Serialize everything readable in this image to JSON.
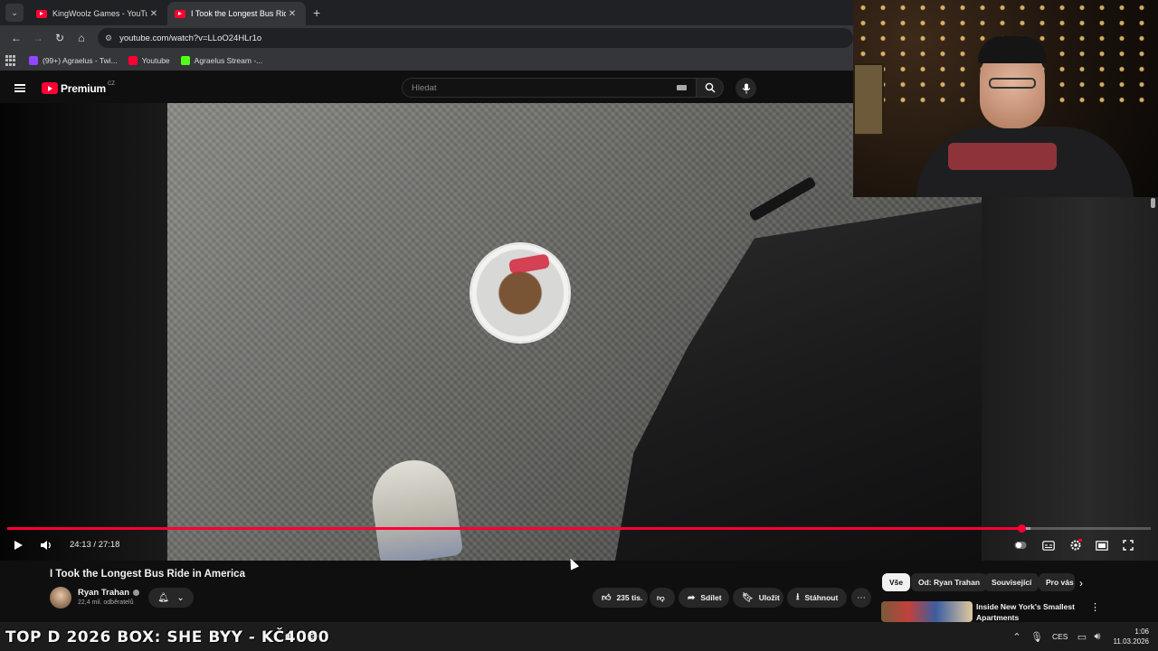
{
  "browser": {
    "tabs": [
      {
        "title": "KingWoolz Games - YouTube",
        "active": false
      },
      {
        "title": "I Took the Longest Bus Ride in A",
        "active": true
      }
    ],
    "new_tab_symbol": "+",
    "url": "youtube.com/watch?v=LLoO24HLr1o",
    "bookmarks": [
      {
        "label": "(99+) Agraelus - Twi...",
        "icon_color": "#9146ff"
      },
      {
        "label": "Youtube",
        "icon_color": "#ff0033"
      },
      {
        "label": "Agraelus Stream -...",
        "icon_color": "#53fc18"
      }
    ]
  },
  "youtube": {
    "logo_text": "Premium",
    "logo_region": "CZ",
    "search_placeholder": "Hledat"
  },
  "player": {
    "current_time": "24:13",
    "duration": "27:18",
    "time_display": "24:13 / 27:18",
    "progress_fraction": 0.887,
    "buffer_fraction": 0.895,
    "accent_color": "#ff0033"
  },
  "video": {
    "title": "I Took the Longest Bus Ride in America",
    "channel": "Ryan Trahan",
    "subscribers": "22,4 mil. odběratelů",
    "likes": "235 tis.",
    "share_label": "Sdílet",
    "save_label": "Uložit",
    "download_label": "Stáhnout"
  },
  "chips": [
    "Vše",
    "Od: Ryan Trahan",
    "Související",
    "Pro vás"
  ],
  "recommendation": {
    "title": "Inside New York's Smallest Apartments"
  },
  "taskbar": {
    "ticker": "TOP D 2026 BOX: SHE  BYY - KČ4000",
    "language": "CES",
    "time": "1:06",
    "date": "11.03.2026"
  }
}
